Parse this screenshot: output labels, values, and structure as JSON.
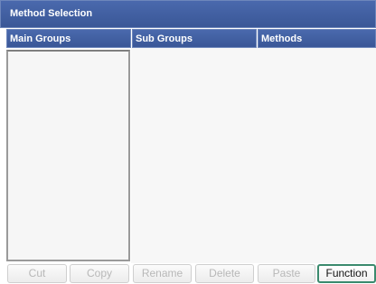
{
  "window": {
    "title": "Method Selection"
  },
  "columns": {
    "main_groups": "Main Groups",
    "sub_groups": "Sub Groups",
    "methods": "Methods"
  },
  "toolbar": {
    "cut": "Cut",
    "copy": "Copy",
    "rename": "Rename",
    "delete": "Delete",
    "paste": "Paste",
    "function": "Function"
  },
  "colors": {
    "header_blue": "#3b5998",
    "function_border": "#3b8a6e"
  }
}
